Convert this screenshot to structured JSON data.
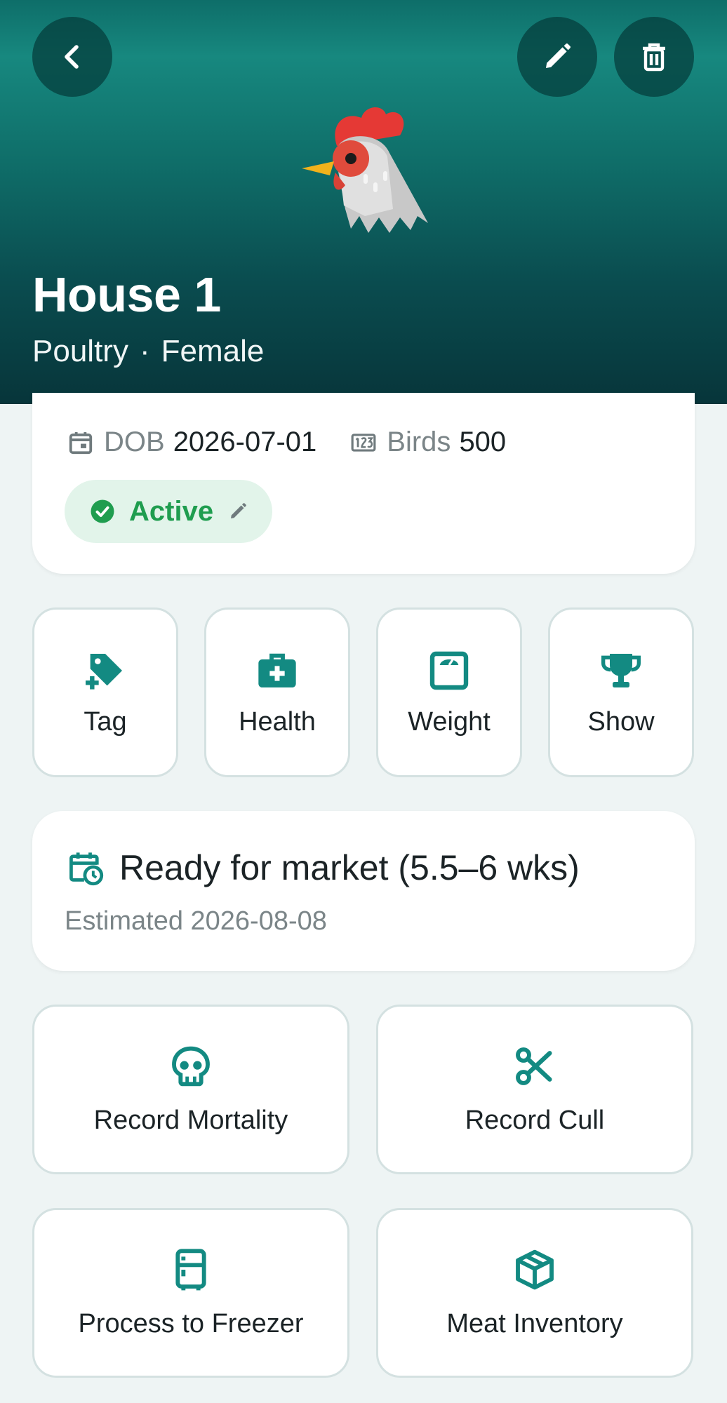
{
  "header": {
    "title": "House 1",
    "species": "Poultry",
    "separator": "·",
    "sex": "Female",
    "colors": {
      "gradient_top": "#17887f",
      "gradient_bottom": "#07353a"
    }
  },
  "info": {
    "dob_label": "DOB",
    "dob_value": "2026-07-01",
    "count_label": "Birds",
    "count_value": "500"
  },
  "status": {
    "label": "Active",
    "color": "#1f9d4f"
  },
  "quick_actions": [
    {
      "label": "Tag",
      "icon": "tag-add-icon"
    },
    {
      "label": "Health",
      "icon": "medical-bag-icon"
    },
    {
      "label": "Weight",
      "icon": "scale-icon"
    },
    {
      "label": "Show",
      "icon": "trophy-icon"
    }
  ],
  "market": {
    "title": "Ready for market (5.5–6 wks)",
    "subtitle": "Estimated 2026-08-08",
    "icon": "calendar-clock-icon"
  },
  "actions": [
    {
      "label": "Record Mortality",
      "icon": "skull-icon"
    },
    {
      "label": "Record Cull",
      "icon": "scissors-icon"
    },
    {
      "label": "Process to Freezer",
      "icon": "fridge-icon"
    },
    {
      "label": "Meat Inventory",
      "icon": "package-icon"
    }
  ],
  "accent": "#138a82"
}
